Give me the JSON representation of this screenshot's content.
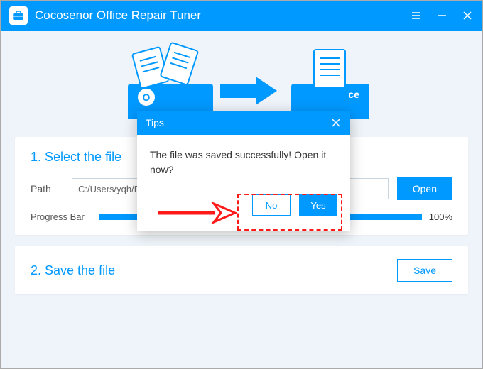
{
  "titlebar": {
    "app_name": "Cocosenor Office Repair Tuner"
  },
  "banner": {
    "left_badge": "O",
    "right_badge": "ce"
  },
  "panel_select": {
    "title": "1. Select the file",
    "path_label": "Path",
    "path_value": "C:/Users/yqh/Deskt",
    "open_button": "Open",
    "progress_label": "Progress Bar",
    "progress_percent": "100%"
  },
  "panel_save": {
    "title": "2. Save the file",
    "save_button": "Save"
  },
  "dialog": {
    "title": "Tips",
    "message": "The file was saved successfully! Open it now?",
    "no_label": "No",
    "yes_label": "Yes"
  }
}
